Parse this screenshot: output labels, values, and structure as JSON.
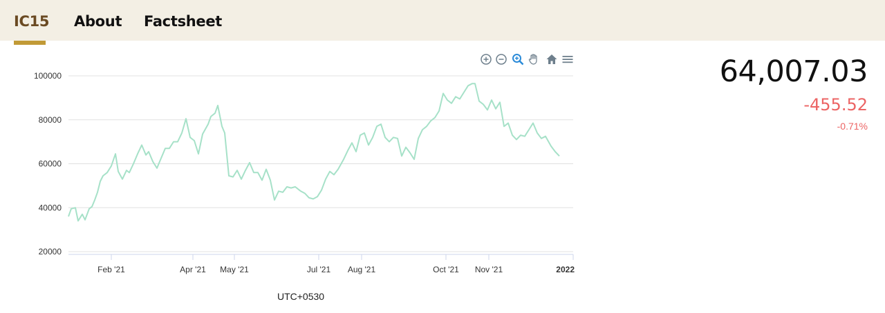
{
  "tabs": [
    {
      "label": "IC15",
      "active": true
    },
    {
      "label": "About",
      "active": false
    },
    {
      "label": "Factsheet",
      "active": false
    }
  ],
  "quote": {
    "price": "64,007.03",
    "change": "-455.52",
    "change_pct": "-0.71%"
  },
  "toolbar": [
    "zoom-in-icon",
    "zoom-out-icon",
    "selection-zoom-icon",
    "pan-icon",
    "reset-home-icon",
    "menu-icon"
  ],
  "colors": {
    "line": "#a6e1c8",
    "negative": "#ec6464",
    "tab_accent": "#c19a36",
    "tab_bg": "#f3efe4",
    "grid": "#e0e0e0"
  },
  "chart_data": {
    "type": "line",
    "xlabel": "UTC+0530",
    "ylim": [
      20000,
      100000
    ],
    "yticks": [
      20000,
      40000,
      60000,
      80000,
      100000
    ],
    "ytick_labels": [
      "20000",
      "40000",
      "60000",
      "80000",
      "100000"
    ],
    "xlim": [
      "2021-01-01",
      "2022-01-01"
    ],
    "xticks": [
      {
        "date": "2021-02-01",
        "label": "Feb '21"
      },
      {
        "date": "2021-04-01",
        "label": "Apr '21"
      },
      {
        "date": "2021-05-01",
        "label": "May '21"
      },
      {
        "date": "2021-07-01",
        "label": "Jul '21"
      },
      {
        "date": "2021-08-01",
        "label": "Aug '21"
      },
      {
        "date": "2021-10-01",
        "label": "Oct '21"
      },
      {
        "date": "2021-11-01",
        "label": "Nov '21"
      },
      {
        "date": "2022-01-01",
        "label": "2022",
        "bold": true
      }
    ],
    "grid": true,
    "series": [
      {
        "points": [
          [
            "2021-01-01",
            36000
          ],
          [
            "2021-01-03",
            39500
          ],
          [
            "2021-01-06",
            40000
          ],
          [
            "2021-01-08",
            34000
          ],
          [
            "2021-01-11",
            37000
          ],
          [
            "2021-01-13",
            34500
          ],
          [
            "2021-01-16",
            39500
          ],
          [
            "2021-01-18",
            40500
          ],
          [
            "2021-01-20",
            43500
          ],
          [
            "2021-01-22",
            47000
          ],
          [
            "2021-01-24",
            52000
          ],
          [
            "2021-01-26",
            54500
          ],
          [
            "2021-01-29",
            56000
          ],
          [
            "2021-02-01",
            59000
          ],
          [
            "2021-02-04",
            64500
          ],
          [
            "2021-02-06",
            56500
          ],
          [
            "2021-02-09",
            53000
          ],
          [
            "2021-02-12",
            57000
          ],
          [
            "2021-02-14",
            56000
          ],
          [
            "2021-02-17",
            60000
          ],
          [
            "2021-02-20",
            64500
          ],
          [
            "2021-02-23",
            68500
          ],
          [
            "2021-02-26",
            64000
          ],
          [
            "2021-02-28",
            65500
          ],
          [
            "2021-03-03",
            61000
          ],
          [
            "2021-03-06",
            58000
          ],
          [
            "2021-03-09",
            62500
          ],
          [
            "2021-03-12",
            67000
          ],
          [
            "2021-03-15",
            67000
          ],
          [
            "2021-03-18",
            70000
          ],
          [
            "2021-03-21",
            70000
          ],
          [
            "2021-03-24",
            74000
          ],
          [
            "2021-03-27",
            80500
          ],
          [
            "2021-03-30",
            72000
          ],
          [
            "2021-04-02",
            70500
          ],
          [
            "2021-04-05",
            64500
          ],
          [
            "2021-04-08",
            73500
          ],
          [
            "2021-04-12",
            78000
          ],
          [
            "2021-04-14",
            81500
          ],
          [
            "2021-04-17",
            83000
          ],
          [
            "2021-04-19",
            86500
          ],
          [
            "2021-04-22",
            77000
          ],
          [
            "2021-04-24",
            74000
          ],
          [
            "2021-04-27",
            54500
          ],
          [
            "2021-04-30",
            54000
          ],
          [
            "2021-05-03",
            57000
          ],
          [
            "2021-05-06",
            53000
          ],
          [
            "2021-05-09",
            57000
          ],
          [
            "2021-05-12",
            60500
          ],
          [
            "2021-05-15",
            56000
          ],
          [
            "2021-05-18",
            56000
          ],
          [
            "2021-05-21",
            52500
          ],
          [
            "2021-05-24",
            57500
          ],
          [
            "2021-05-27",
            52500
          ],
          [
            "2021-05-30",
            43500
          ],
          [
            "2021-06-02",
            47500
          ],
          [
            "2021-06-05",
            47000
          ],
          [
            "2021-06-08",
            49500
          ],
          [
            "2021-06-11",
            49000
          ],
          [
            "2021-06-14",
            49500
          ],
          [
            "2021-06-18",
            47500
          ],
          [
            "2021-06-21",
            46500
          ],
          [
            "2021-06-24",
            44500
          ],
          [
            "2021-06-27",
            44000
          ],
          [
            "2021-06-30",
            45000
          ],
          [
            "2021-07-03",
            48000
          ],
          [
            "2021-07-06",
            53000
          ],
          [
            "2021-07-09",
            56500
          ],
          [
            "2021-07-12",
            55000
          ],
          [
            "2021-07-15",
            57500
          ],
          [
            "2021-07-19",
            62000
          ],
          [
            "2021-07-22",
            66000
          ],
          [
            "2021-07-25",
            69500
          ],
          [
            "2021-07-28",
            65500
          ],
          [
            "2021-07-31",
            73000
          ],
          [
            "2021-08-03",
            74000
          ],
          [
            "2021-08-06",
            68500
          ],
          [
            "2021-08-09",
            72000
          ],
          [
            "2021-08-12",
            77000
          ],
          [
            "2021-08-15",
            78000
          ],
          [
            "2021-08-18",
            72000
          ],
          [
            "2021-08-21",
            70000
          ],
          [
            "2021-08-24",
            72000
          ],
          [
            "2021-08-27",
            71500
          ],
          [
            "2021-08-30",
            63500
          ],
          [
            "2021-09-02",
            67500
          ],
          [
            "2021-09-05",
            65000
          ],
          [
            "2021-09-08",
            62000
          ],
          [
            "2021-09-11",
            71500
          ],
          [
            "2021-09-14",
            75500
          ],
          [
            "2021-09-17",
            77000
          ],
          [
            "2021-09-20",
            79500
          ],
          [
            "2021-09-23",
            81000
          ],
          [
            "2021-09-26",
            84000
          ],
          [
            "2021-09-29",
            92000
          ],
          [
            "2021-10-02",
            89000
          ],
          [
            "2021-10-05",
            87500
          ],
          [
            "2021-10-08",
            90500
          ],
          [
            "2021-10-11",
            89500
          ],
          [
            "2021-10-14",
            92500
          ],
          [
            "2021-10-17",
            95500
          ],
          [
            "2021-10-20",
            96500
          ],
          [
            "2021-10-22",
            96500
          ],
          [
            "2021-10-25",
            88500
          ],
          [
            "2021-10-28",
            87000
          ],
          [
            "2021-10-31",
            84500
          ],
          [
            "2021-11-03",
            89000
          ],
          [
            "2021-11-06",
            85000
          ],
          [
            "2021-11-09",
            88000
          ],
          [
            "2021-11-12",
            77000
          ],
          [
            "2021-11-15",
            78500
          ],
          [
            "2021-11-18",
            73000
          ],
          [
            "2021-11-21",
            71000
          ],
          [
            "2021-11-24",
            73000
          ],
          [
            "2021-11-27",
            72500
          ],
          [
            "2021-11-30",
            75500
          ],
          [
            "2021-12-03",
            78500
          ],
          [
            "2021-12-06",
            74000
          ],
          [
            "2021-12-09",
            71500
          ],
          [
            "2021-12-12",
            72500
          ],
          [
            "2021-12-16",
            68000
          ],
          [
            "2021-12-19",
            65500
          ],
          [
            "2021-12-22",
            63500
          ]
        ]
      }
    ]
  }
}
